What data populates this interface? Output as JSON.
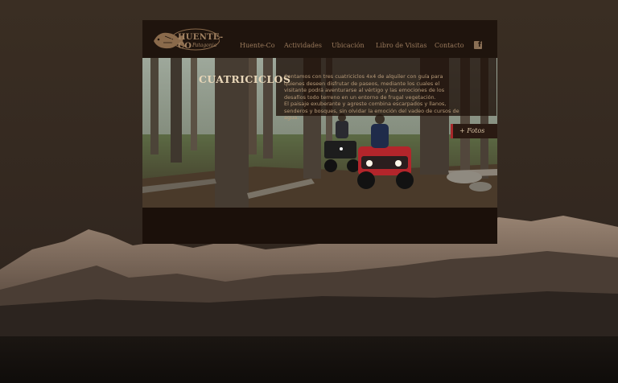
{
  "brand": {
    "name": "HUENTE-CO",
    "tagline": "Patagonia",
    "logo_icon": "trout-fish-icon"
  },
  "nav": {
    "items": [
      {
        "label": "Huente-Co"
      },
      {
        "label": "Actividades"
      },
      {
        "label": "Ubicación"
      },
      {
        "label": "Libro de Visitas"
      },
      {
        "label": "Contacto"
      }
    ],
    "facebook_icon": "facebook-icon",
    "facebook_glyph": "f"
  },
  "section": {
    "title": "CUATRICICLOS",
    "paragraph_1": "Contamos con tres cuatriciclos 4x4 de alquiler con guía para quienes deseen disfrutar de paseos, mediante los cuales el visitante podrá aventurarse al vértigo y las emociones de los desafíos todo terreno en un entorno de frugal vegetación.",
    "paragraph_2": "El paisaje exuberante y agreste combina escarpados y llanos, senderos y bosques, sin olvidar la emoción del vadeo de cursos de agua.",
    "fotos_link": "+ Fotos"
  },
  "colors": {
    "background": "#332820",
    "panel": "#1d130d",
    "nav_text": "#9a7a5c",
    "accent_red": "#a8282a"
  }
}
